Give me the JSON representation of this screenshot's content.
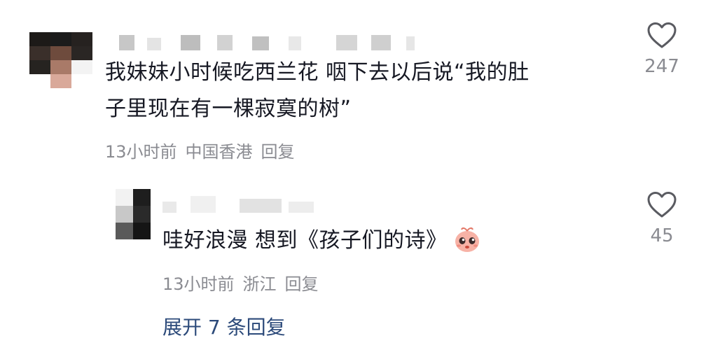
{
  "comment": {
    "text_line1": "我妹妹小时候吃西兰花 咽下去以后说“我的肚",
    "text_line2": "子里现在有一棵寂寞的树”",
    "time": "13小时前",
    "location": "中国香港",
    "reply_label": "回复",
    "likes": "247",
    "like_icon": "heart-outline-icon"
  },
  "reply": {
    "text": "哇好浪漫 想到《孩子们的诗》",
    "emoji": "pleading-face-emoji",
    "time": "13小时前",
    "location": "浙江",
    "reply_label": "回复",
    "likes": "45",
    "like_icon": "heart-outline-icon"
  },
  "expand_replies": "展开 7 条回复",
  "colors": {
    "text": "#161823",
    "meta": "#8a8b91",
    "link": "#2c4a7a"
  }
}
